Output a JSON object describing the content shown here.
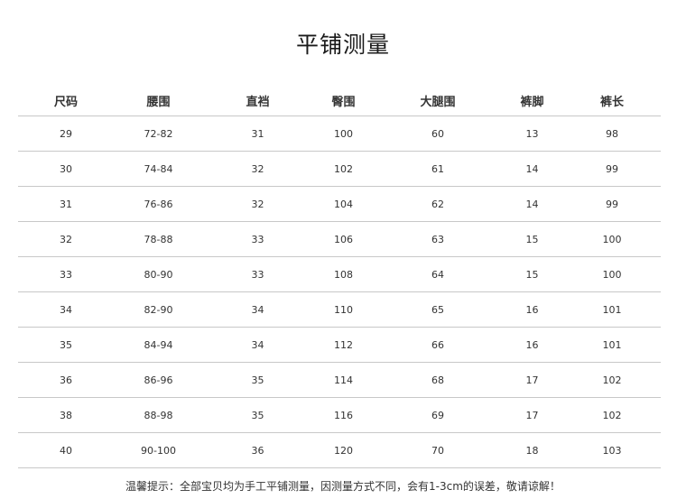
{
  "title": "平铺测量",
  "headers": [
    "尺码",
    "腰围",
    "直裆",
    "臀围",
    "大腿围",
    "裤脚",
    "裤长"
  ],
  "rows": [
    [
      "29",
      "72-82",
      "31",
      "100",
      "60",
      "13",
      "98"
    ],
    [
      "30",
      "74-84",
      "32",
      "102",
      "61",
      "14",
      "99"
    ],
    [
      "31",
      "76-86",
      "32",
      "104",
      "62",
      "14",
      "99"
    ],
    [
      "32",
      "78-88",
      "33",
      "106",
      "63",
      "15",
      "100"
    ],
    [
      "33",
      "80-90",
      "33",
      "108",
      "64",
      "15",
      "100"
    ],
    [
      "34",
      "82-90",
      "34",
      "110",
      "65",
      "16",
      "101"
    ],
    [
      "35",
      "84-94",
      "34",
      "112",
      "66",
      "16",
      "101"
    ],
    [
      "36",
      "86-96",
      "35",
      "114",
      "68",
      "17",
      "102"
    ],
    [
      "38",
      "88-98",
      "35",
      "116",
      "69",
      "17",
      "102"
    ],
    [
      "40",
      "90-100",
      "36",
      "120",
      "70",
      "18",
      "103"
    ]
  ],
  "note": "温馨提示：全部宝贝均为手工平铺测量，因测量方式不同，会有1-3cm的误差，敬请谅解！"
}
